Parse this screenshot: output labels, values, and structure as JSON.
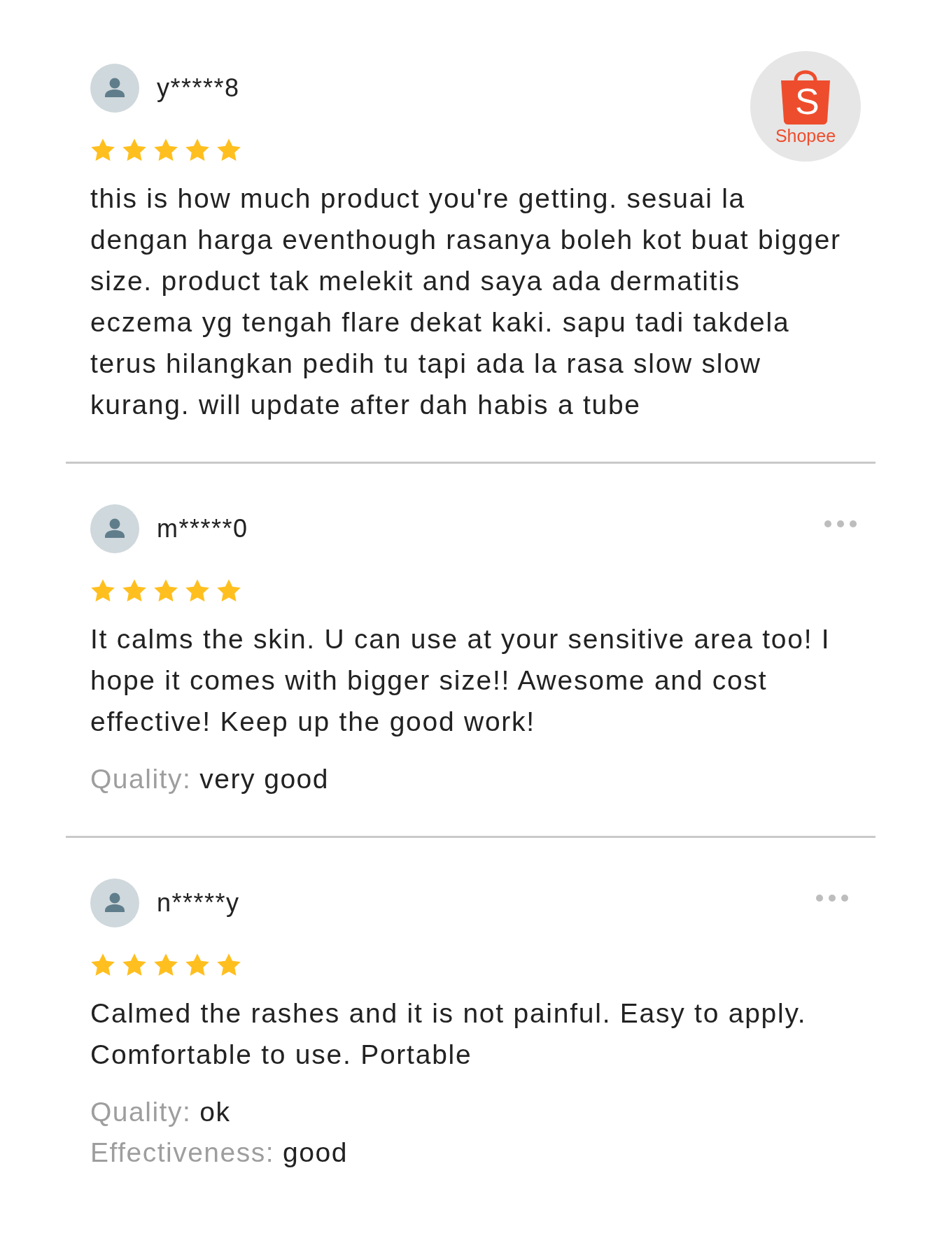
{
  "logo": {
    "letter": "S",
    "wordmark": "Shopee"
  },
  "reviews": [
    {
      "username": "y*****8",
      "stars": 5,
      "more_menu": false,
      "text": "this is how much product you're getting. sesuai la dengan harga eventhough rasanya boleh kot buat bigger size. product tak melekit and saya ada dermatitis eczema yg tengah flare dekat kaki. sapu tadi takdela terus hilangkan pedih tu tapi ada la rasa slow slow kurang. will update after dah habis a tube"
    },
    {
      "username": "m*****0",
      "stars": 5,
      "more_menu": true,
      "text": "It calms the skin. U can use at your sensitive area too! I hope it comes with bigger size!! Awesome and cost effective! Keep up the good work!",
      "attributes": [
        {
          "label": "Quality:",
          "value": "very good"
        }
      ]
    },
    {
      "username": "n*****y",
      "stars": 5,
      "more_menu": true,
      "text": "Calmed the rashes and it is not painful. Easy to apply. Comfortable to use. Portable",
      "attributes": [
        {
          "label": "Quality:",
          "value": "ok"
        },
        {
          "label": "Effectiveness:",
          "value": "good"
        }
      ]
    }
  ]
}
